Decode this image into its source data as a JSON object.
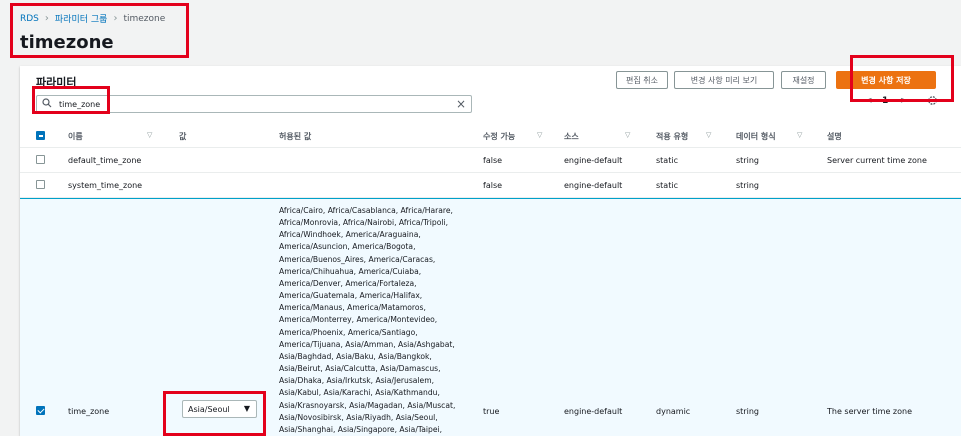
{
  "breadcrumb": [
    "RDS",
    "파라미터 그룹",
    "timezone"
  ],
  "page_title": "timezone",
  "panel_title": "파라미터",
  "buttons": {
    "cancel_edit": "편집 취소",
    "preview": "변경 사항 미리 보기",
    "reset": "재설정",
    "save": "변경 사항 저장"
  },
  "search": {
    "value": "time_zone",
    "placeholder": ""
  },
  "pager": {
    "page": "1",
    "prev": "<",
    "next": ">"
  },
  "columns": {
    "name": "이름",
    "value": "값",
    "allowed": "허용된 값",
    "modifiable": "수정 가능",
    "source": "소스",
    "apply_type": "적용 유형",
    "data_type": "데이터 형식",
    "description": "설명"
  },
  "rows": [
    {
      "name": "default_time_zone",
      "value": "",
      "modifiable": "false",
      "source": "engine-default",
      "apply_type": "static",
      "data_type": "string",
      "description": "Server current time zone"
    },
    {
      "name": "system_time_zone",
      "value": "",
      "modifiable": "false",
      "source": "engine-default",
      "apply_type": "static",
      "data_type": "string",
      "description": ""
    },
    {
      "name": "time_zone",
      "value": "Asia/Seoul",
      "modifiable": "true",
      "source": "engine-default",
      "apply_type": "dynamic",
      "data_type": "string",
      "description": "The server time zone",
      "allowed": "Africa/Cairo, Africa/Casablanca, Africa/Harare, Africa/Monrovia, Africa/Nairobi, Africa/Tripoli, Africa/Windhoek, America/Araguaina, America/Asuncion, America/Bogota, America/Buenos_Aires, America/Caracas, America/Chihuahua, America/Cuiaba, America/Denver, America/Fortaleza, America/Guatemala, America/Halifax, America/Manaus, America/Matamoros, America/Monterrey, America/Montevideo, America/Phoenix, America/Santiago, America/Tijuana, Asia/Amman, Asia/Ashgabat, Asia/Baghdad, Asia/Baku, Asia/Bangkok, Asia/Beirut, Asia/Calcutta, Asia/Damascus, Asia/Dhaka, Asia/Irkutsk, Asia/Jerusalem, Asia/Kabul, Asia/Karachi, Asia/Kathmandu, Asia/Krasnoyarsk, Asia/Magadan, Asia/Muscat, Asia/Novosibirsk, Asia/Riyadh, Asia/Seoul, Asia/Shanghai, Asia/Singapore, Asia/Taipei,"
    }
  ],
  "colors": {
    "accent": "#ec7211",
    "link": "#0073bb",
    "highlight": "#e3001b",
    "selected_row": "#f1faff"
  }
}
